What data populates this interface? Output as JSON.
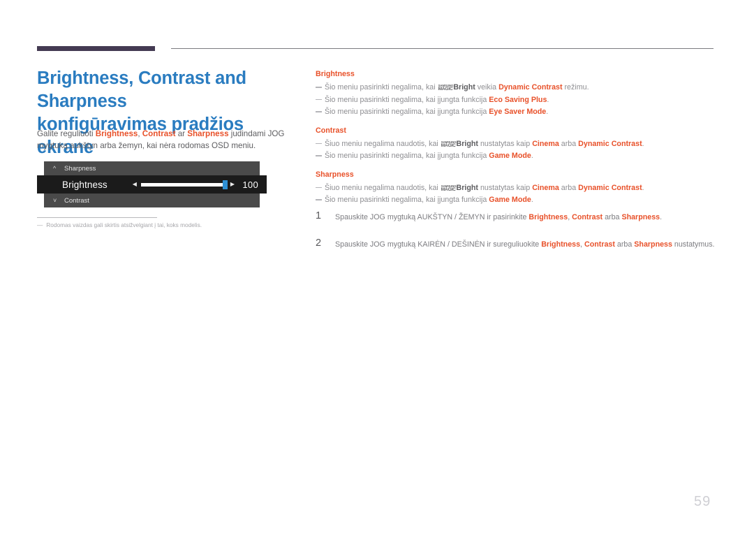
{
  "header": {
    "rule_color": "#443a52",
    "line_color": "#7b7b80"
  },
  "left": {
    "title_line1": "Brightness, Contrast and Sharpness",
    "title_line2": "konfigūravimas pradžios ekrane",
    "title_color": "#2a7cc0",
    "intro": {
      "t1": "Galite reguliuoti ",
      "k1": "Brightness",
      "t2": ", ",
      "k2": "Contrast",
      "t3": " ar ",
      "k3": "Sharpness",
      "t4": " judindami JOG mygtuką aukštyn arba žemyn, kai nėra rodomas OSD meniu."
    },
    "osd": {
      "row_top_label": "Sharpness",
      "row_top_icon": "chevron-up-icon",
      "row_active_label": "Brightness",
      "row_active_value": "100",
      "arrow_left": "◀",
      "arrow_right": "▶",
      "row_bottom_label": "Contrast",
      "row_bottom_icon": "chevron-down-icon",
      "knob_color": "#2e8fd4"
    },
    "footnote": {
      "dash": "―",
      "text": "Rodomas vaizdas gali skirtis atsižvelgiant į tai, koks modelis."
    }
  },
  "right": {
    "groups": [
      {
        "heading": "Brightness",
        "notes": [
          {
            "p1": "Šio meniu pasirinkti negalima, kai ",
            "logo": {
              "l1": "SAMSUNG",
              "l2": "MAGIC"
            },
            "bold_dark": "Bright",
            "p2": " veikia ",
            "bold_red": "Dynamic Contrast",
            "p3": " režimu."
          },
          {
            "p1": "Šio meniu pasirinkti negalima, kai įjungta funkcija ",
            "bold_red": "Eco Saving Plus",
            "p3": "."
          },
          {
            "p1": "Šio meniu pasirinkti negalima, kai įjungta funkcija ",
            "bold_red": "Eye Saver Mode",
            "p3": "."
          }
        ]
      },
      {
        "heading": "Contrast",
        "notes": [
          {
            "p1": "Šiuo meniu negalima naudotis, kai ",
            "logo": {
              "l1": "SAMSUNG",
              "l2": "MAGIC"
            },
            "bold_dark": "Bright",
            "p2": " nustatytas kaip ",
            "bold_red": "Cinema",
            "p2b": " arba ",
            "bold_red2": "Dynamic Contrast",
            "p3": "."
          },
          {
            "p1": "Šio meniu pasirinkti negalima, kai įjungta funkcija ",
            "bold_red": "Game Mode",
            "p3": "."
          }
        ]
      },
      {
        "heading": "Sharpness",
        "notes": [
          {
            "p1": "Šiuo meniu negalima naudotis, kai ",
            "logo": {
              "l1": "SAMSUNG",
              "l2": "MAGIC"
            },
            "bold_dark": "Bright",
            "p2": " nustatytas kaip ",
            "bold_red": "Cinema",
            "p2b": " arba ",
            "bold_red2": "Dynamic Contrast",
            "p3": "."
          },
          {
            "p1": "Šio meniu pasirinkti negalima, kai įjungta funkcija ",
            "bold_red": "Game Mode",
            "p3": "."
          }
        ]
      }
    ]
  },
  "steps": [
    {
      "num": "1",
      "p1": "Spauskite JOG mygtuką AUKŠTYN / ŽEMYN ir pasirinkite ",
      "k1": "Brightness",
      "p2": ", ",
      "k2": "Contrast",
      "p3": " arba ",
      "k3": "Sharpness",
      "p4": "."
    },
    {
      "num": "2",
      "p1": "Spauskite JOG mygtuką KAIRĖN / DEŠINĖN ir sureguliuokite ",
      "k1": "Brightness",
      "p2": ", ",
      "k2": "Contrast",
      "p3": " arba ",
      "k3": "Sharpness",
      "p4": " nustatymus."
    }
  ],
  "page_number": "59"
}
